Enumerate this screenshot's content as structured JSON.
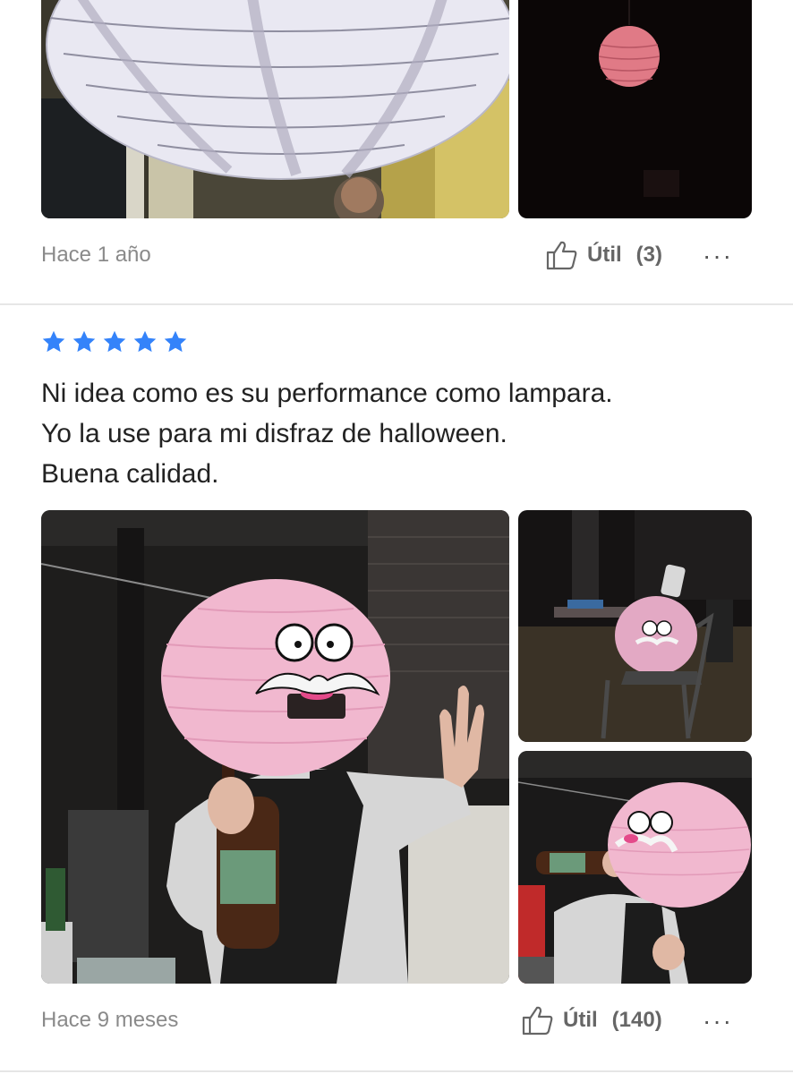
{
  "colors": {
    "star": "#3483fa",
    "divider": "#e6e6e6",
    "meta": "#8a8a8a"
  },
  "reviews": [
    {
      "date": "Hace 1 año",
      "helpful_label": "Útil",
      "helpful_count": "(3)",
      "more_label": "···",
      "photos": [
        "white-paper-lantern-photo",
        "pink-lantern-dark-photo"
      ]
    },
    {
      "rating": 5,
      "text_lines": [
        "Ni idea como es su performance como lampara.",
        "Yo la use para mi disfraz de halloween.",
        "Buena calidad."
      ],
      "date": "Hace 9 meses",
      "helpful_label": "Útil",
      "helpful_count": "(140)",
      "more_label": "···",
      "photos": [
        "costume-main-photo",
        "costume-chair-photo",
        "costume-drinking-photo"
      ]
    }
  ]
}
